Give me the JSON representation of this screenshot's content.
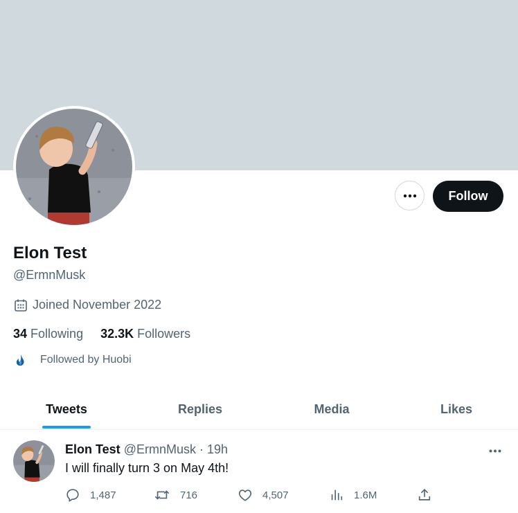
{
  "profile": {
    "name": "Elon Test",
    "handle": "@ErmnMusk",
    "joined": "Joined November 2022",
    "following_count": "34",
    "following_label": "Following",
    "followers_count": "32.3K",
    "followers_label": "Followers",
    "followed_by": "Followed by Huobi"
  },
  "actions": {
    "follow_label": "Follow"
  },
  "tabs": [
    {
      "label": "Tweets",
      "active": true
    },
    {
      "label": "Replies",
      "active": false
    },
    {
      "label": "Media",
      "active": false
    },
    {
      "label": "Likes",
      "active": false
    }
  ],
  "tweet": {
    "name": "Elon Test",
    "handle": "@ErmnMusk",
    "separator": "·",
    "time": "19h",
    "text": "I will finally turn 3 on May 4th!",
    "replies": "1,487",
    "retweets": "716",
    "likes": "4,507",
    "views": "1.6M"
  },
  "icons": [
    "more-icon",
    "calendar-icon",
    "huobi-flame-icon",
    "reply-icon",
    "retweet-icon",
    "like-icon",
    "views-icon",
    "share-icon"
  ],
  "colors": {
    "accent": "#1d9bf0",
    "banner": "#cfd9de",
    "follow_bg": "#0f1419",
    "muted_text": "#536471"
  }
}
